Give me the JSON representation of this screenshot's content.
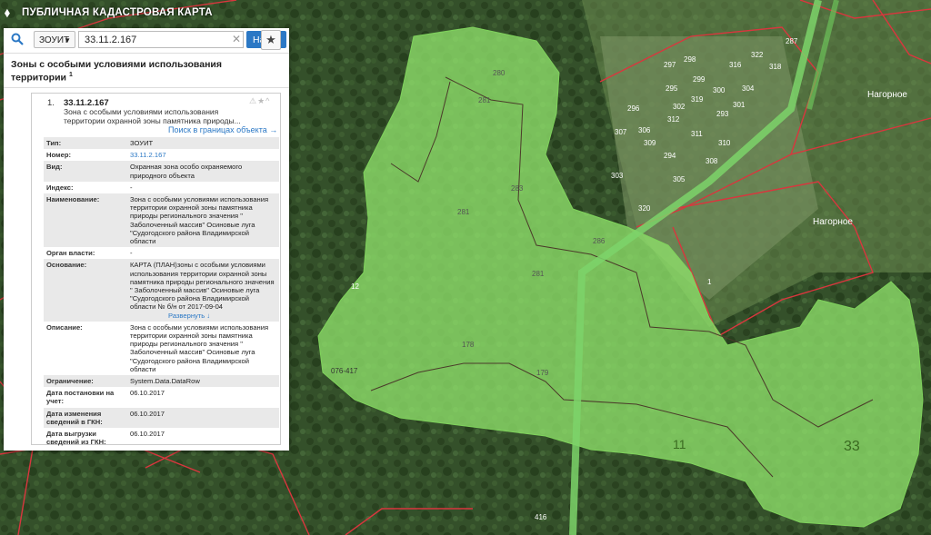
{
  "app": {
    "title": "ПУБЛИЧНАЯ КАДАСТРОВАЯ КАРТА"
  },
  "search": {
    "type_value": "ЗОУИТ",
    "query": "33.11.2.167",
    "button_label": "Найти"
  },
  "category": {
    "title": "Зоны с особыми условиями использования территории",
    "count": "1"
  },
  "result": {
    "index": "1.",
    "id": "33.11.2.167",
    "description": "Зона с особыми условиями использования территории охранной зоны памятника природы...",
    "search_link": "Поиск в границах объекта →"
  },
  "attributes": [
    {
      "key": "Тип:",
      "value": "ЗОУИТ"
    },
    {
      "key": "Номер:",
      "value": "33.11.2.167"
    },
    {
      "key": "Вид:",
      "value": "Охранная зона особо охраняемого природного объекта"
    },
    {
      "key": "Индекс:",
      "value": "-"
    },
    {
      "key": "Наименование:",
      "value": "Зона с особыми условиями использования территории охранной зоны памятника природы регионального значения \" Заболоченный массив\" Осиновые луга \"Судогодского района Владимирской области"
    },
    {
      "key": "Орган власти:",
      "value": "-"
    },
    {
      "key": "Основание:",
      "value": "КАРТА (ПЛАН)зоны с особыми условиями использования территории охранной зоны памятника природы регионального значения \" Заболоченный массив\" Осиновые луга \"Судогодского района Владимирской области № б/н от 2017-09-04",
      "more": "Развернуть ↓"
    },
    {
      "key": "Описание:",
      "value": "Зона с особыми условиями использования территории охранной зоны памятника природы регионального значения \" Заболоченный массив\" Осиновые луга \"Судогодского района Владимирской области"
    },
    {
      "key": "Ограничение:",
      "value": "System.Data.DataRow"
    },
    {
      "key": "Дата постановки на учет:",
      "value": "06.10.2017"
    },
    {
      "key": "Дата изменения сведений в ГКН:",
      "value": "06.10.2017"
    },
    {
      "key": "Дата выгрузки сведений из ГКН:",
      "value": "06.10.2017"
    }
  ],
  "map": {
    "place_labels": [
      "Нагорное",
      "Нагорное"
    ],
    "zone_labels": [
      "076-417",
      "11",
      "11",
      "33"
    ],
    "parcel_labels": [
      "280",
      "281",
      "281",
      "283",
      "286",
      "281",
      "178",
      "179",
      "12",
      "416",
      "318",
      "287",
      "1"
    ],
    "village_labels": [
      "322",
      "316",
      "299",
      "300",
      "301",
      "297",
      "298",
      "295",
      "302",
      "319",
      "293",
      "304",
      "296",
      "312",
      "311",
      "306",
      "307",
      "309",
      "310",
      "294",
      "305",
      "303",
      "320",
      "308"
    ],
    "colors": {
      "zone_fill": "#8ee06a",
      "parcel_line": "#d9363e"
    }
  }
}
